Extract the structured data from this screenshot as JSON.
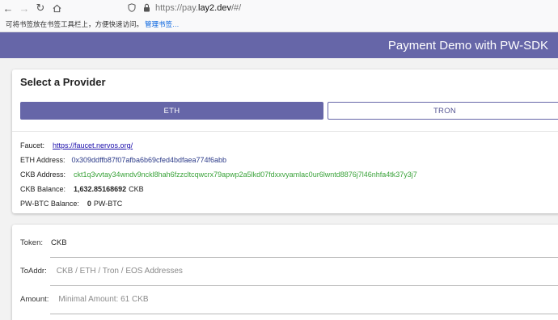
{
  "browser": {
    "url_prefix": "https://pay.",
    "url_host": "lay2.dev",
    "url_suffix": "/#/",
    "bookmark_hint": "可将书签放在书签工具栏上，方便快速访问。",
    "bookmark_manage_link": "管理书签…"
  },
  "app": {
    "title": "Payment Demo with PW-SDK"
  },
  "provider_card": {
    "heading": "Select a Provider",
    "tabs": [
      {
        "label": "ETH",
        "selected": true
      },
      {
        "label": "TRON",
        "selected": false
      }
    ],
    "faucet": {
      "label": "Faucet:",
      "value": "https://faucet.nervos.org/"
    },
    "eth_address": {
      "label": "ETH Address:",
      "value": "0x309ddffb87f07afba6b69cfed4bdfaea774f6abb"
    },
    "ckb_address": {
      "label": "CKB Address:",
      "value": "ckt1q3vvtay34wndv9nckl8hah6fzzcltcqwcrx79apwp2a5lkd07fdxxvyamlac0ur6lwntd8876j7l46nhfa4tk37y3j7"
    },
    "ckb_balance": {
      "label": "CKB Balance:",
      "amount": "1,632.85168692",
      "unit": "CKB"
    },
    "pwbtc_balance": {
      "label": "PW-BTC Balance:",
      "amount": "0",
      "unit": "PW-BTC"
    }
  },
  "form_card": {
    "token": {
      "label": "Token:",
      "value": "CKB"
    },
    "to_addr": {
      "label": "ToAddr:",
      "placeholder": "CKB / ETH / Tron / EOS Addresses"
    },
    "amount": {
      "label": "Amount:",
      "placeholder": "Minimal Amount: 61 CKB"
    }
  },
  "colors": {
    "brand": "#6666a8",
    "eth_hash": "#2b3a88",
    "ckb_hash": "#3aa33a",
    "link": "#1a0dab"
  }
}
